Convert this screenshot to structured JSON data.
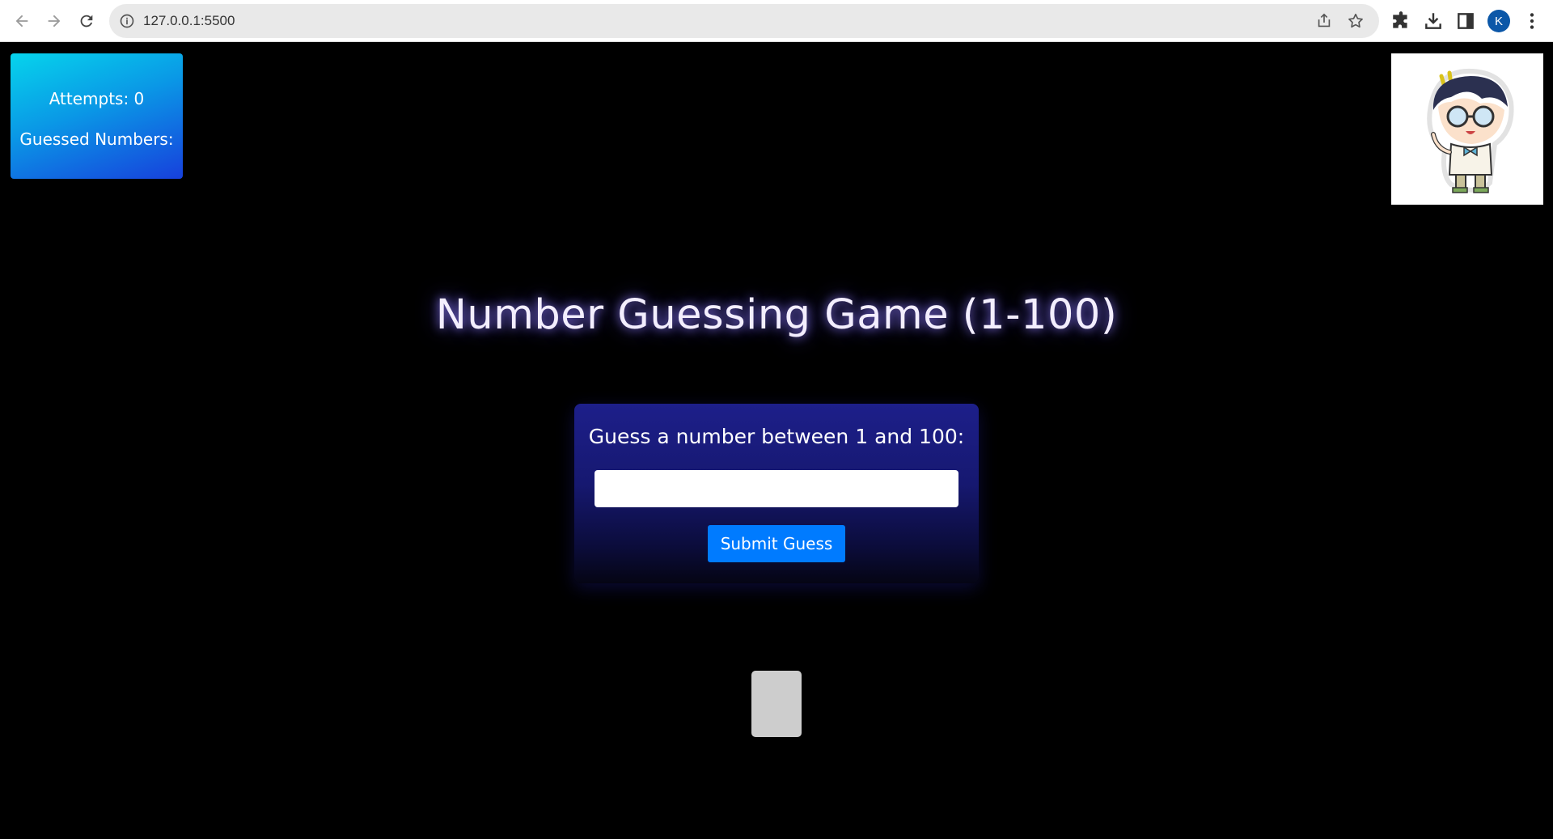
{
  "browser": {
    "url": "127.0.0.1:5500",
    "profile_initial": "K",
    "icons": [
      "back-icon",
      "forward-icon",
      "reload-icon",
      "info-icon",
      "share-icon",
      "star-icon",
      "extensions-icon",
      "download-icon",
      "side-panel-icon",
      "menu-icon"
    ]
  },
  "stats": {
    "attempts": "Attempts: 0",
    "guessed": "Guessed Numbers:"
  },
  "game": {
    "title": "Number Guessing Game (1-100)",
    "prompt": "Guess a number between 1 and 100:",
    "input_value": "",
    "submit_label": "Submit Guess"
  },
  "colors": {
    "page_bg": "#000000",
    "button": "#007bff",
    "card_top": "#1d1f8a",
    "stats_gradient_start": "#06d4ec",
    "stats_gradient_end": "#1740dc"
  }
}
